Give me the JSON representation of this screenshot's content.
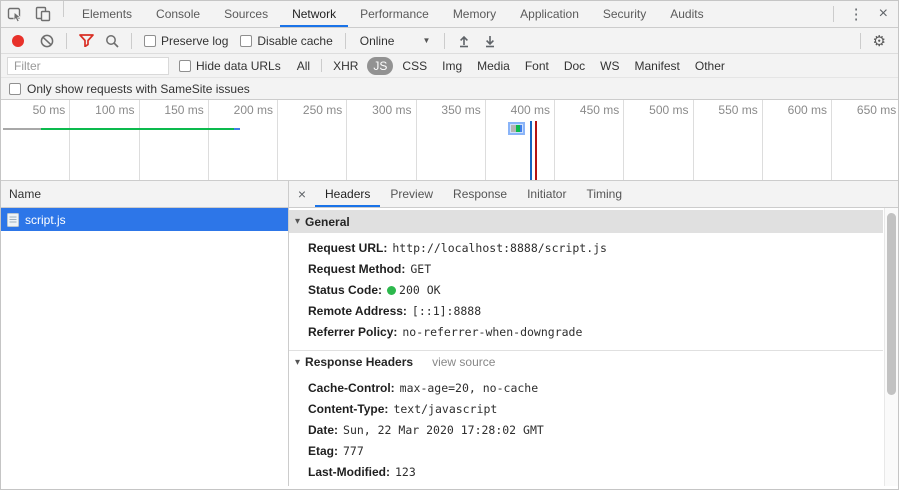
{
  "colors": {
    "accent_blue": "#1a73e8",
    "record_red": "#e8312a",
    "filter_funnel_red": "#d93025",
    "selected_row_blue": "#2d76e8",
    "status_green": "#2db84d",
    "waterfall_gray": "#a8a8a8",
    "waterfall_green": "#0cba4d",
    "waterfall_blue": "#3f7ee8",
    "dcl_line_blue": "#1665c0",
    "load_line_red": "#b31412",
    "toolbar_bg": "#f3f3f3"
  },
  "icons": {
    "kebab": "⋮",
    "window_close": "×",
    "panel_close": "×",
    "gear": "⚙",
    "select_caret": "▼",
    "disclosure": "▾"
  },
  "main_tabs": [
    "Elements",
    "Console",
    "Sources",
    "Network",
    "Performance",
    "Memory",
    "Application",
    "Security",
    "Audits"
  ],
  "selected_main_tab": "Network",
  "network_toolbar": {
    "preserve_log_label": "Preserve log",
    "disable_cache_label": "Disable cache",
    "throttling_value": "Online"
  },
  "filter_bar": {
    "placeholder": "Filter",
    "hide_data_urls_label": "Hide data URLs",
    "types": [
      "All",
      "XHR",
      "JS",
      "CSS",
      "Img",
      "Media",
      "Font",
      "Doc",
      "WS",
      "Manifest",
      "Other"
    ],
    "selected_type": "JS"
  },
  "samesite_label": "Only show requests with SameSite issues",
  "overview": {
    "ticks": [
      "50 ms",
      "100 ms",
      "150 ms",
      "200 ms",
      "250 ms",
      "300 ms",
      "350 ms",
      "400 ms",
      "450 ms",
      "500 ms",
      "550 ms",
      "600 ms",
      "650 ms"
    ]
  },
  "requests_table": {
    "name_header": "Name",
    "rows": [
      {
        "name": "script.js"
      }
    ],
    "selected_row": "script.js"
  },
  "detail": {
    "tabs": [
      "Headers",
      "Preview",
      "Response",
      "Initiator",
      "Timing"
    ],
    "selected_tab": "Headers",
    "general": {
      "title": "General",
      "rows": [
        {
          "key": "Request URL:",
          "value": "http://localhost:8888/script.js"
        },
        {
          "key": "Request Method:",
          "value": "GET"
        },
        {
          "key": "Status Code:",
          "value": "200 OK"
        },
        {
          "key": "Remote Address:",
          "value": "[::1]:8888"
        },
        {
          "key": "Referrer Policy:",
          "value": "no-referrer-when-downgrade"
        }
      ]
    },
    "response_headers": {
      "title": "Response Headers",
      "view_source_label": "view source",
      "rows": [
        {
          "key": "Cache-Control:",
          "value": "max-age=20, no-cache"
        },
        {
          "key": "Content-Type:",
          "value": "text/javascript"
        },
        {
          "key": "Date:",
          "value": "Sun, 22 Mar 2020 17:28:02 GMT"
        },
        {
          "key": "Etag:",
          "value": "777"
        },
        {
          "key": "Last-Modified:",
          "value": "123"
        }
      ]
    }
  }
}
